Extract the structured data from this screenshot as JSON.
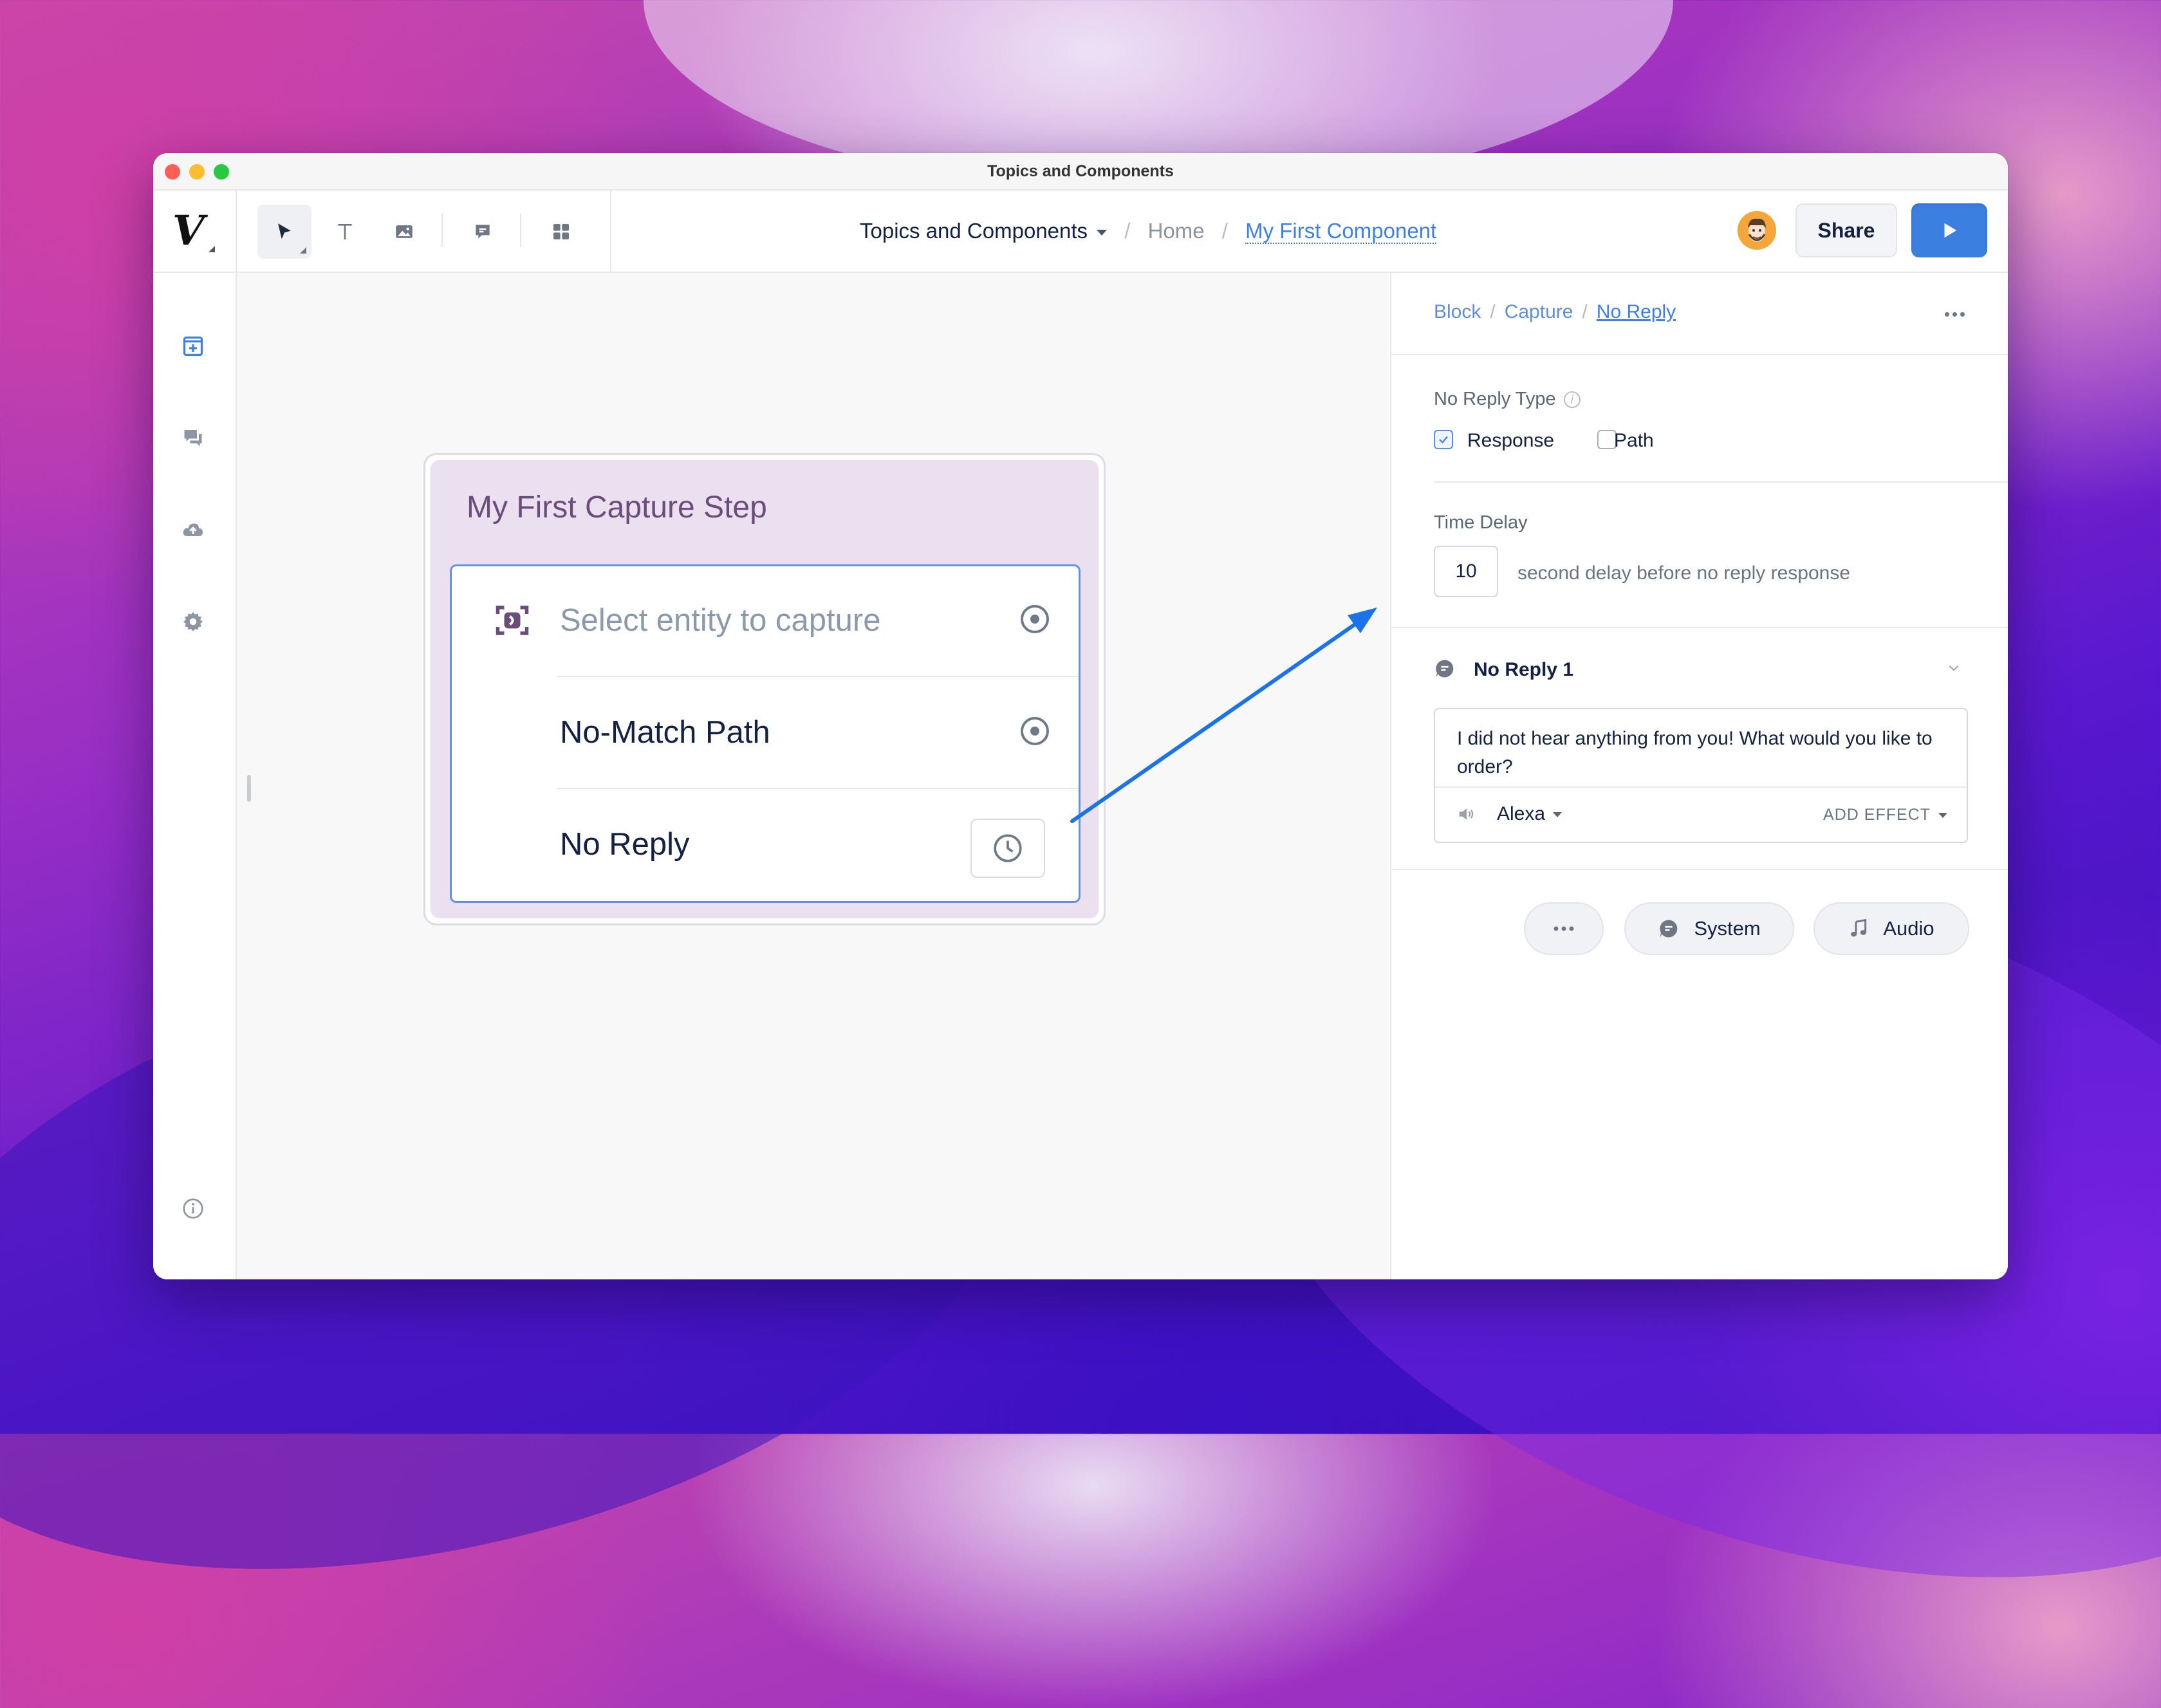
{
  "window": {
    "title": "Topics and Components"
  },
  "toolbar": {
    "logo": "V",
    "tools": [
      "select-tool",
      "text-tool",
      "image-tool",
      "comment-tool",
      "components-tool"
    ]
  },
  "breadcrumb": {
    "project": "Topics and Components",
    "home": "Home",
    "current": "My First Component",
    "separator": "/"
  },
  "header": {
    "share_label": "Share",
    "run_icon": "play-icon"
  },
  "sidebar": {
    "icons": [
      "add-block-icon",
      "chat-icon",
      "upload-icon",
      "settings-icon",
      "info-icon"
    ]
  },
  "canvas": {
    "block": {
      "title": "My First Capture Step",
      "rows": [
        {
          "label": "Select entity to capture",
          "icon": "capture-entity-icon",
          "port": "port-icon"
        },
        {
          "label": "No-Match Path",
          "port": "port-icon"
        },
        {
          "label": "No Reply",
          "port": "clock-icon"
        }
      ]
    }
  },
  "panel": {
    "breadcrumb": [
      "Block",
      "Capture",
      "No Reply"
    ],
    "no_reply_type_label": "No Reply Type",
    "options": [
      {
        "label": "Response",
        "checked": true
      },
      {
        "label": "Path",
        "checked": false
      }
    ],
    "time_delay_label": "Time Delay",
    "time_delay_value": "10",
    "time_delay_suffix": "second delay before no reply response",
    "no_reply_title": "No Reply 1",
    "reply_text": "I did not hear anything from you! What would you like to order?",
    "voice": "Alexa",
    "add_effect": "ADD EFFECT",
    "buttons": {
      "more": "more-icon",
      "system": "System",
      "audio": "Audio"
    }
  },
  "colors": {
    "accent": "#3b7fe0",
    "block_bg": "#ebe0ef",
    "block_title": "#6b4c7d",
    "annotation_arrow": "#1a73e8"
  }
}
